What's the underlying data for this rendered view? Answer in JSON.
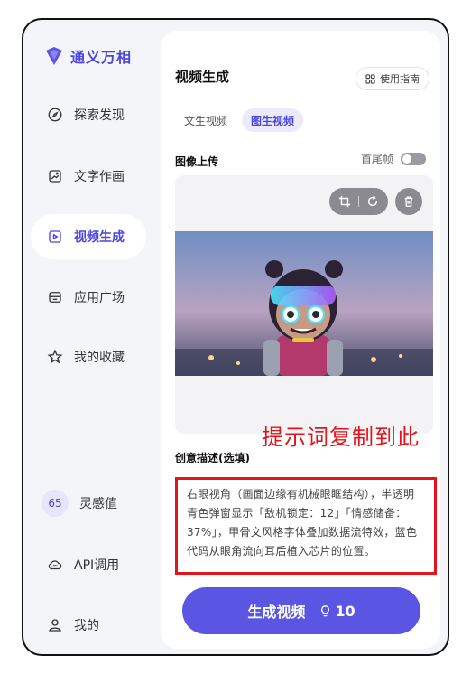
{
  "app": {
    "name": "通义万相"
  },
  "sidebar": {
    "items": [
      {
        "label": "探索发现",
        "icon": "compass-icon"
      },
      {
        "label": "文字作画",
        "icon": "image-icon"
      },
      {
        "label": "视频生成",
        "icon": "video-icon",
        "active": true
      },
      {
        "label": "应用广场",
        "icon": "app-square-icon"
      },
      {
        "label": "我的收藏",
        "icon": "star-icon"
      }
    ],
    "bottom": [
      {
        "label": "灵感值",
        "value": "65"
      },
      {
        "label": "API调用",
        "icon": "api-cloud-icon"
      },
      {
        "label": "我的",
        "icon": "user-icon"
      }
    ]
  },
  "main": {
    "title": "视频生成",
    "guide_label": "使用指南",
    "tabs": [
      {
        "label": "文生视频",
        "active": false
      },
      {
        "label": "图生视频",
        "active": true
      }
    ],
    "upload_label": "图像上传",
    "first_last_frame_label": "首尾帧",
    "first_last_frame_on": false,
    "description_label": "创意描述(选填)",
    "description_text": "右眼视角（画面边缘有机械眼眶结构），半透明青色弹窗显示「敌机锁定：12」「情感储备：37%」，甲骨文风格字体叠加数据流特效，蓝色代码从眼角流向耳后植入芯片的位置。",
    "generate_label": "生成视频",
    "cost": "10"
  },
  "annotation": "提示词复制到此",
  "colors": {
    "accent": "#5b55e3",
    "annotation": "#e3141b"
  }
}
